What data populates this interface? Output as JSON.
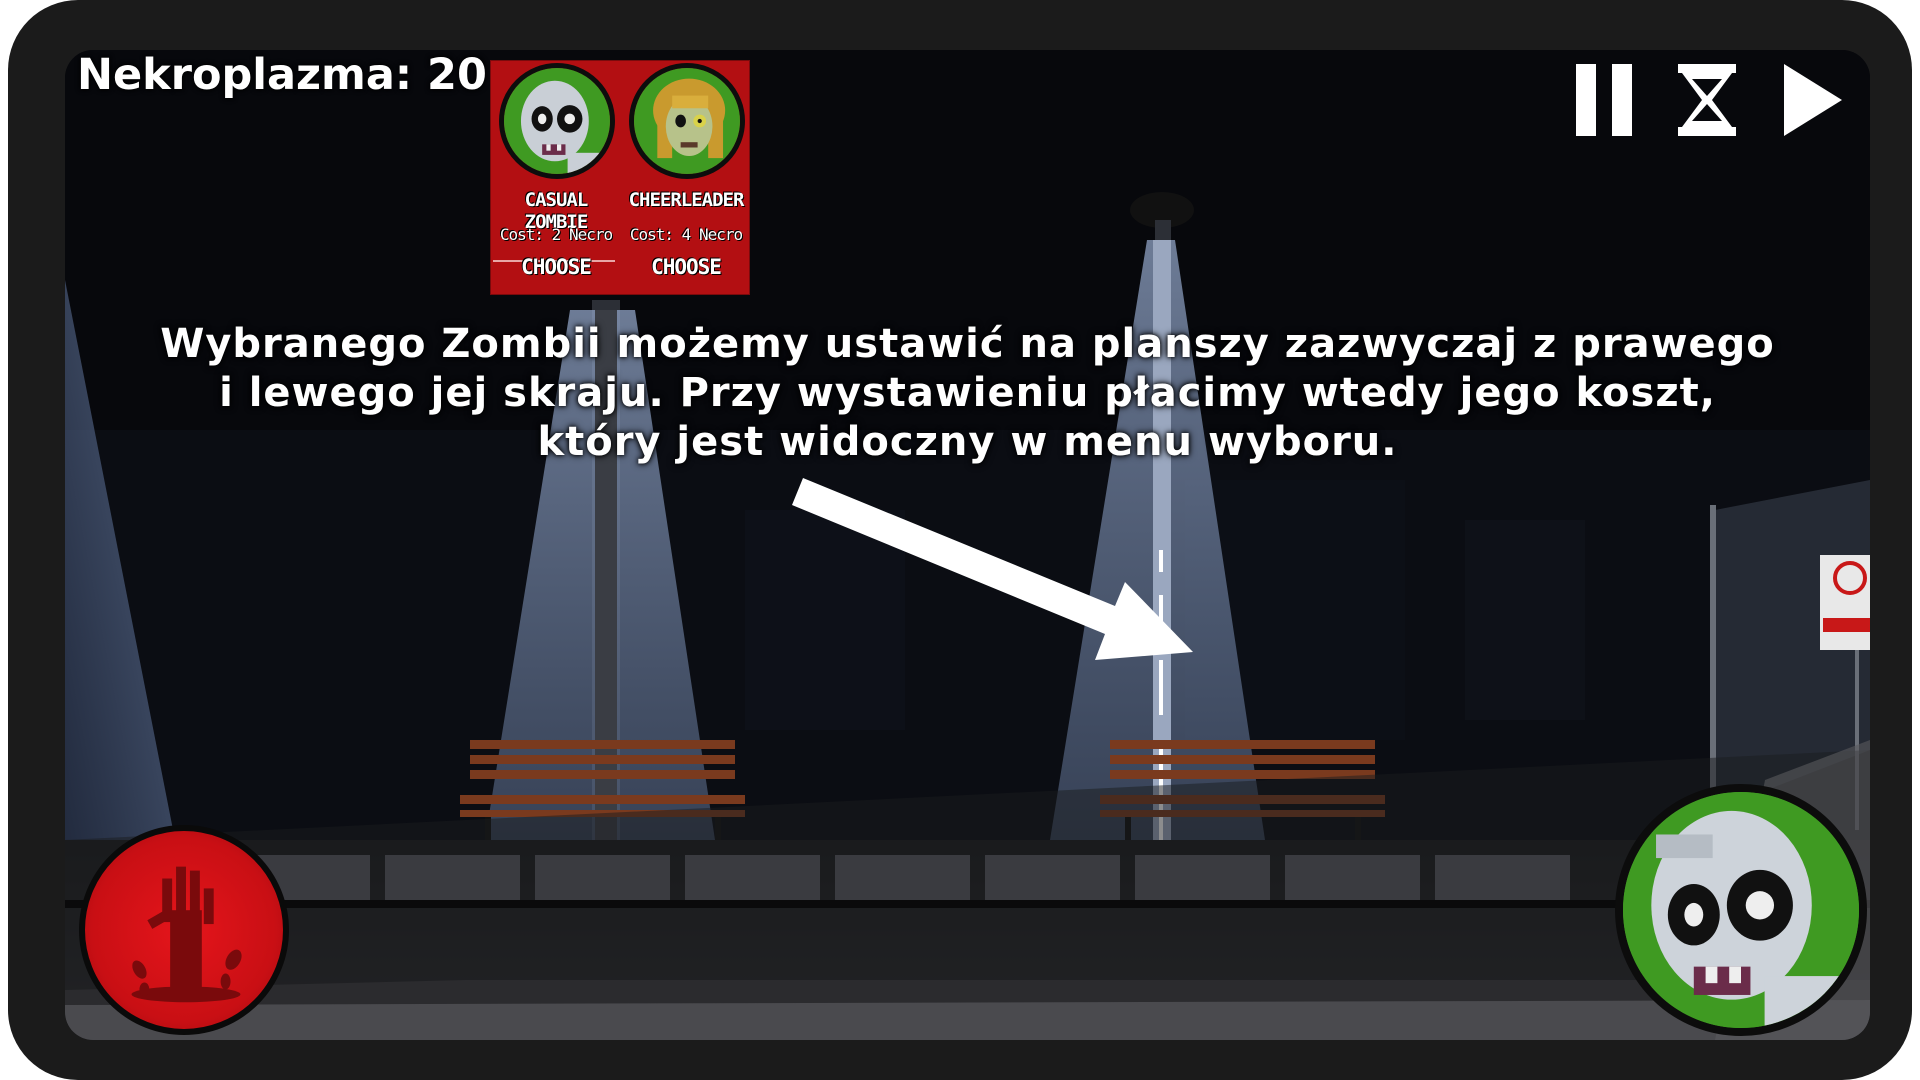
{
  "hud": {
    "currency_label": "Nekroplazma: 20"
  },
  "chooser": {
    "cards": [
      {
        "name": "CASUAL ZOMBIE",
        "cost": "Cost: 2 Necro",
        "action": "CHOOSE",
        "portrait_icon": "casual-zombie-icon",
        "bg": "#3f9a22"
      },
      {
        "name": "CHEERLEADER",
        "cost": "Cost: 4 Necro",
        "action": "CHOOSE",
        "portrait_icon": "cheerleader-zombie-icon",
        "bg": "#3f9a22"
      }
    ],
    "panel_color": "#b30f12"
  },
  "controls": {
    "pause_icon": "pause-icon",
    "speed_icon": "hourglass-icon",
    "play_icon": "play-icon"
  },
  "tutorial": {
    "lines": [
      "Wybranego Zombii możemy ustawić na planszy zazwyczaj z prawego",
      "i lewego jej skraju. Przy wystawieniu płacimy wtedy jego koszt,",
      "który jest widoczny w menu wyboru."
    ]
  },
  "buttons": {
    "ability_icon": "zombie-hand-icon",
    "selected_unit_icon": "casual-zombie-icon",
    "ability_color": "#d31218",
    "unit_color": "#3f9a22"
  }
}
